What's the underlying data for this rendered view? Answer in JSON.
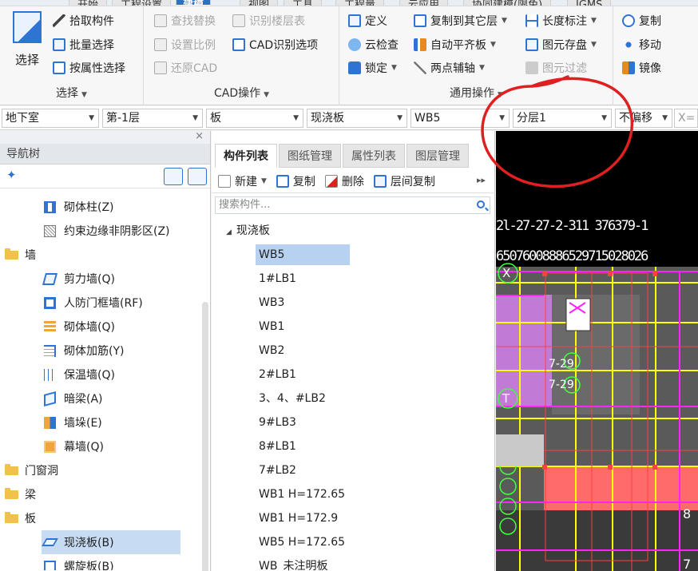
{
  "menu": {
    "tabs": [
      "开始",
      "工程设置",
      "建模",
      "视图",
      "工具",
      "工程量",
      "云应用",
      "协同建模(限免)",
      "IGMS"
    ],
    "active_tab": "建模"
  },
  "ribbon": {
    "select_group": {
      "big_button": "选择",
      "items": [
        "拾取构件",
        "批量选择",
        "按属性选择"
      ],
      "label": "选择"
    },
    "cad_group": {
      "items": [
        "查找替换",
        "识别楼层表",
        "设置比例",
        "CAD识别选项",
        "还原CAD"
      ],
      "label": "CAD操作"
    },
    "common_group": {
      "items": [
        "定义",
        "复制到其它层",
        "长度标注",
        "云检查",
        "自动平齐板",
        "图元存盘",
        "锁定",
        "两点辅轴",
        "图元过滤"
      ],
      "label": "通用操作"
    },
    "modify_group": {
      "items": [
        "复制",
        "移动",
        "镜像"
      ]
    }
  },
  "combos": {
    "floor_type": "地下室",
    "floor": "第-1层",
    "category": "板",
    "sub_category": "现浇板",
    "component": "WB5",
    "layer": "分层1",
    "offset": "不偏移",
    "coord_x": "X="
  },
  "nav": {
    "title": "导航树",
    "close": "×",
    "items": [
      {
        "label": "砌体柱(Z)",
        "level": 1,
        "icon": "column-icon"
      },
      {
        "label": "约束边缘非阴影区(Z)",
        "level": 1,
        "icon": "constraint-edge-icon"
      },
      {
        "label": "墙",
        "level": 0,
        "icon": "folder-icon"
      },
      {
        "label": "剪力墙(Q)",
        "level": 1,
        "icon": "shear-wall-icon"
      },
      {
        "label": "人防门框墙(RF)",
        "level": 1,
        "icon": "door-frame-wall-icon"
      },
      {
        "label": "砌体墙(Q)",
        "level": 1,
        "icon": "masonry-wall-icon"
      },
      {
        "label": "砌体加筋(Y)",
        "level": 1,
        "icon": "masonry-rebar-icon"
      },
      {
        "label": "保温墙(Q)",
        "level": 1,
        "icon": "insulation-wall-icon"
      },
      {
        "label": "暗梁(A)",
        "level": 1,
        "icon": "hidden-beam-icon"
      },
      {
        "label": "墙垛(E)",
        "level": 1,
        "icon": "wall-pier-icon"
      },
      {
        "label": "幕墙(Q)",
        "level": 1,
        "icon": "curtain-wall-icon"
      },
      {
        "label": "门窗洞",
        "level": 0,
        "icon": "folder-icon"
      },
      {
        "label": "梁",
        "level": 0,
        "icon": "folder-icon"
      },
      {
        "label": "板",
        "level": 0,
        "icon": "folder-icon"
      },
      {
        "label": "现浇板(B)",
        "level": 1,
        "icon": "slab-icon",
        "selected": true
      },
      {
        "label": "螺旋板(B)",
        "level": 1,
        "icon": "spiral-slab-icon"
      }
    ]
  },
  "component_panel": {
    "tabs": [
      "构件列表",
      "图纸管理",
      "属性列表",
      "图层管理"
    ],
    "active_tab": "构件列表",
    "toolbar": {
      "new": "新建",
      "copy": "复制",
      "delete": "删除",
      "floor_copy": "层间复制"
    },
    "search_placeholder": "搜索构件...",
    "group": "现浇板",
    "items": [
      "WB5",
      "1#LB1",
      "WB3",
      "WB1",
      "WB2",
      "2#LB1",
      "3、4、#LB2",
      "9#LB3",
      "8#LB1",
      "7#LB2",
      "WB1 H=172.65",
      "WB1 H=172.9",
      "WB5 H=172.65",
      "WB_未注明板"
    ],
    "selected": "WB5"
  },
  "canvas": {
    "dim_row1": "2l-27-27-2-311   376379-1",
    "dim_row2": "65076008886529715028026",
    "axis_x": "X",
    "axis_t": "T",
    "label_729": "7-29",
    "label_7e": "8",
    "label_71": "7"
  },
  "colors": {
    "accent": "#2f73d3",
    "annotation": "#e02020",
    "cad_yellow": "#ffff00",
    "cad_magenta": "#ff22ff",
    "cad_red": "#ff4040",
    "cad_green": "#40ff40"
  }
}
